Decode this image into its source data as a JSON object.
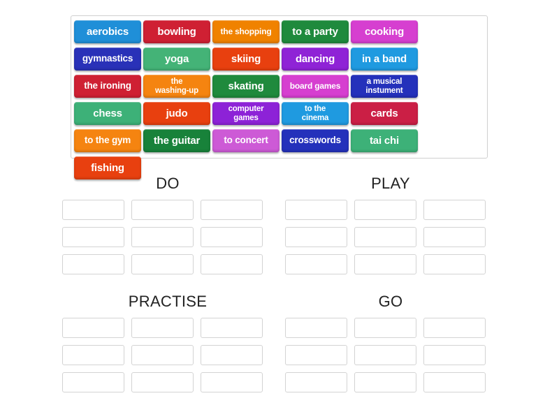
{
  "activity": {
    "type": "group-sort",
    "bank_label": "word-bank"
  },
  "colors": {
    "blue": "#1f8fd8",
    "crimson": "#cf2033",
    "orange": "#f08200",
    "green_dark": "#1f8a3d",
    "magenta": "#d63fd0",
    "navy": "#2931b8",
    "green_mint": "#44b377",
    "red_orange": "#e8400f",
    "purple": "#8f23d6",
    "blue_light": "#1f9ae0",
    "red_deep": "#cf2033",
    "orange_bright": "#f58410",
    "green_forest": "#18823a",
    "orchid": "#cd5ad6",
    "blue_royal": "#2431bb",
    "green_sea": "#3db178",
    "crimson_rose": "#cb1f45",
    "violet": "#8d22d7",
    "text_on_tile": "#ffffff",
    "heading": "#222222",
    "slot_border": "#d3d3d3",
    "bank_border": "#cfcfcf",
    "page_bg": "#ffffff"
  },
  "tiles": [
    {
      "label": "aerobics",
      "color": "#1f8fd8",
      "size": "s-lg",
      "lines": 1
    },
    {
      "label": "bowling",
      "color": "#cf2033",
      "size": "s-lg",
      "lines": 1
    },
    {
      "label": "the shopping",
      "color": "#f08200",
      "size": "s-sm",
      "lines": 1
    },
    {
      "label": "to a party",
      "color": "#1f8a3d",
      "size": "s-lg",
      "lines": 1
    },
    {
      "label": "cooking",
      "color": "#d63fd0",
      "size": "s-lg",
      "lines": 1
    },
    {
      "label": "gymnastics",
      "color": "#2931b8",
      "size": "s-md",
      "lines": 1
    },
    {
      "label": "yoga",
      "color": "#44b377",
      "size": "s-lg",
      "lines": 1
    },
    {
      "label": "skiing",
      "color": "#e8400f",
      "size": "s-lg",
      "lines": 1
    },
    {
      "label": "dancing",
      "color": "#8f23d6",
      "size": "s-lg",
      "lines": 1
    },
    {
      "label": "in a band",
      "color": "#1f9ae0",
      "size": "s-lg",
      "lines": 1
    },
    {
      "label": "the ironing",
      "color": "#cf2033",
      "size": "s-md",
      "lines": 1
    },
    {
      "label": "the washing-up",
      "color": "#f58410",
      "size": "two-line",
      "lines": 2,
      "line1": "the",
      "line2": "washing-up"
    },
    {
      "label": "skating",
      "color": "#1f8a3d",
      "size": "s-lg",
      "lines": 1
    },
    {
      "label": "board games",
      "color": "#d63fd0",
      "size": "s-sm",
      "lines": 1
    },
    {
      "label": "a musical instument",
      "color": "#2431bb",
      "size": "two-line",
      "lines": 2,
      "line1": "a musical",
      "line2": "instument"
    },
    {
      "label": "chess",
      "color": "#3db178",
      "size": "s-lg",
      "lines": 1
    },
    {
      "label": "judo",
      "color": "#e8400f",
      "size": "s-lg",
      "lines": 1
    },
    {
      "label": "computer games",
      "color": "#8d22d7",
      "size": "two-line",
      "lines": 2,
      "line1": "computer",
      "line2": "games"
    },
    {
      "label": "to the cinema",
      "color": "#1f9ae0",
      "size": "two-line",
      "lines": 2,
      "line1": "to the",
      "line2": "cinema"
    },
    {
      "label": "cards",
      "color": "#cb1f45",
      "size": "s-lg",
      "lines": 1
    },
    {
      "label": "to the gym",
      "color": "#f58410",
      "size": "s-md",
      "lines": 1
    },
    {
      "label": "the guitar",
      "color": "#18823a",
      "size": "s-lg",
      "lines": 1
    },
    {
      "label": "to concert",
      "color": "#cd5ad6",
      "size": "s-md",
      "lines": 1
    },
    {
      "label": "crosswords",
      "color": "#2431bb",
      "size": "s-md",
      "lines": 1
    },
    {
      "label": "tai chi",
      "color": "#3db178",
      "size": "s-lg",
      "lines": 1
    },
    {
      "label": "fishing",
      "color": "#e8400f",
      "size": "s-lg",
      "lines": 1
    }
  ],
  "categories": [
    {
      "id": "do",
      "title": "DO",
      "slots": 9
    },
    {
      "id": "play",
      "title": "PLAY",
      "slots": 9
    },
    {
      "id": "practise",
      "title": "PRACTISE",
      "slots": 9
    },
    {
      "id": "go",
      "title": "GO",
      "slots": 9
    }
  ]
}
